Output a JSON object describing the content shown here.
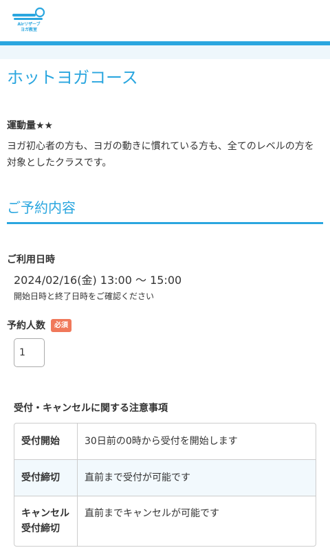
{
  "brand": {
    "logo_line1": "Airリザーブ",
    "logo_line2": "ヨガ教室",
    "accent_color": "#2aa6df",
    "logo_icon": "yoga-mat-logo-icon"
  },
  "course": {
    "title": "ホットヨガコース",
    "intensity": "運動量★★",
    "description": "ヨガ初心者の方も、ヨガの動きに慣れている方も、全てのレベルの方を対象としたクラスです。"
  },
  "reservation": {
    "heading": "ご予約内容",
    "datetime_label": "ご利用日時",
    "datetime_value": "2024/02/16(金) 13:00 〜 15:00",
    "datetime_note": "開始日時と終了日時をご確認ください",
    "people_label": "予約人数",
    "required_badge": "必須",
    "people_value": "1"
  },
  "notice": {
    "heading": "受付・キャンセルに関する注意事項",
    "rows": [
      {
        "key": "受付開始",
        "value": "30日前の0時から受付を開始します"
      },
      {
        "key": "受付締切",
        "value": "直前まで受付が可能です"
      },
      {
        "key": "キャンセル受付締切",
        "value": "直前までキャンセルが可能です"
      }
    ]
  }
}
